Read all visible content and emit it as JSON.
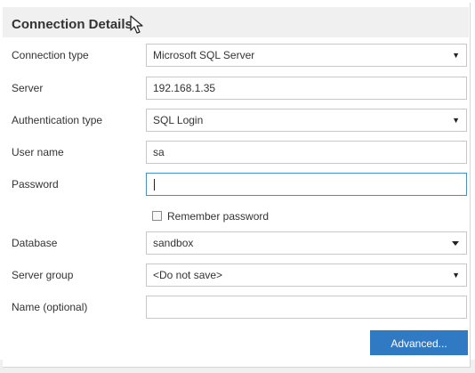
{
  "header": {
    "title": "Connection Details"
  },
  "form": {
    "connection_type": {
      "label": "Connection type",
      "value": "Microsoft SQL Server"
    },
    "server": {
      "label": "Server",
      "value": "192.168.1.35"
    },
    "auth_type": {
      "label": "Authentication type",
      "value": "SQL Login"
    },
    "user_name": {
      "label": "User name",
      "value": "sa"
    },
    "password": {
      "label": "Password",
      "value": ""
    },
    "remember_password": {
      "label": "Remember password",
      "checked": false
    },
    "database": {
      "label": "Database",
      "value": "sandbox"
    },
    "server_group": {
      "label": "Server group",
      "value": "<Do not save>"
    },
    "name": {
      "label": "Name (optional)",
      "value": ""
    }
  },
  "actions": {
    "advanced_label": "Advanced..."
  },
  "icons": {
    "dropdown": "triangle-down-icon",
    "database_dropdown": "caret-down-icon",
    "cursor": "mouse-pointer-icon"
  },
  "colors": {
    "accent": "#3079c3",
    "focus_border": "#4a8ec6",
    "header_bg": "#f0f0f0"
  }
}
